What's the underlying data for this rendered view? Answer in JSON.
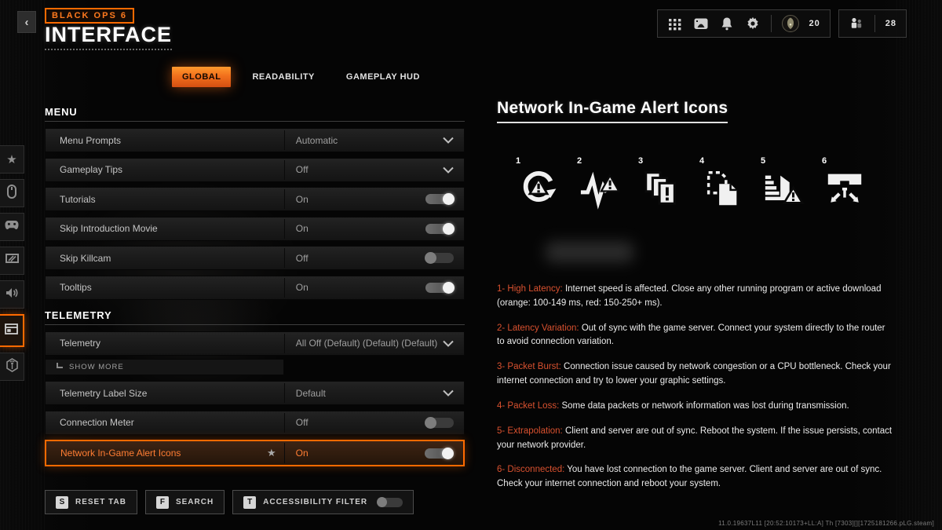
{
  "colors": {
    "accent": "#ff6a00",
    "alert_red": "#d9512f",
    "tab_active_bg": "#f2701c"
  },
  "header": {
    "back_icon": "‹",
    "game_badge": "BLACK OPS 6",
    "title": "INTERFACE"
  },
  "topbar": {
    "icons": [
      "grid-icon",
      "photo-icon",
      "bell-icon",
      "gear-icon"
    ],
    "currency_count": "20",
    "social_count": "28"
  },
  "tabs": [
    {
      "label": "GLOBAL",
      "active": true
    },
    {
      "label": "READABILITY",
      "active": false
    },
    {
      "label": "GAMEPLAY HUD",
      "active": false
    }
  ],
  "sidebar": {
    "items": [
      {
        "name": "favorites",
        "icon": "star-icon",
        "glyph": "★"
      },
      {
        "name": "mouse",
        "icon": "mouse-icon"
      },
      {
        "name": "controller",
        "icon": "gamepad-icon"
      },
      {
        "name": "display",
        "icon": "monitor-icon"
      },
      {
        "name": "audio",
        "icon": "speaker-icon"
      },
      {
        "name": "interface",
        "icon": "layout-icon",
        "active": true
      },
      {
        "name": "network",
        "icon": "antenna-icon"
      }
    ]
  },
  "settings": {
    "sections": [
      {
        "title": "MENU",
        "rows": [
          {
            "label": "Menu Prompts",
            "value": "Automatic",
            "control": "dropdown"
          },
          {
            "label": "Gameplay Tips",
            "value": "Off",
            "control": "dropdown"
          },
          {
            "label": "Tutorials",
            "value": "On",
            "control": "toggle",
            "state": "on"
          },
          {
            "label": "Skip Introduction Movie",
            "value": "On",
            "control": "toggle",
            "state": "on"
          },
          {
            "label": "Skip Killcam",
            "value": "Off",
            "control": "toggle",
            "state": "off"
          },
          {
            "label": "Tooltips",
            "value": "On",
            "control": "toggle",
            "state": "on"
          }
        ]
      },
      {
        "title": "TELEMETRY",
        "rows": [
          {
            "label": "Telemetry",
            "value": "All Off (Default) (Default) (Default)",
            "control": "dropdown",
            "subrow": "SHOW MORE"
          },
          {
            "label": "Telemetry Label Size",
            "value": "Default",
            "control": "dropdown"
          },
          {
            "label": "Connection Meter",
            "value": "Off",
            "control": "toggle",
            "state": "off"
          },
          {
            "label": "Network In-Game Alert Icons",
            "value": "On",
            "control": "toggle",
            "state": "on",
            "active": true,
            "starred": true,
            "star_glyph": "★"
          }
        ]
      }
    ]
  },
  "footer": {
    "buttons": [
      {
        "key": "S",
        "label": "RESET TAB"
      },
      {
        "key": "F",
        "label": "SEARCH"
      },
      {
        "key": "T",
        "label": "ACCESSIBILITY FILTER",
        "toggle": "off"
      }
    ],
    "version": "11.0.19637L11 [20:52:10173+LL:A] Th [7303][][1725181266.pLG.steam]"
  },
  "detail": {
    "title": "Network In-Game Alert Icons",
    "icons": [
      {
        "num": "1",
        "name": "high-latency-icon"
      },
      {
        "num": "2",
        "name": "latency-variation-icon"
      },
      {
        "num": "3",
        "name": "packet-burst-icon"
      },
      {
        "num": "4",
        "name": "packet-loss-icon"
      },
      {
        "num": "5",
        "name": "extrapolation-icon"
      },
      {
        "num": "6",
        "name": "disconnected-icon"
      }
    ],
    "descriptions": [
      {
        "lead": "1- High Latency:",
        "text": " Internet speed is affected. Close any other running program or active download (orange: 100-149 ms, red: 150-250+ ms)."
      },
      {
        "lead": "2- Latency Variation:",
        "text": " Out of sync with the game server. Connect your system directly to the router to avoid connection variation."
      },
      {
        "lead": "3- Packet Burst:",
        "text": " Connection issue caused by network congestion or a CPU bottleneck. Check your internet connection and try to lower your graphic settings."
      },
      {
        "lead": "4- Packet Loss:",
        "text": " Some data packets or network information was lost during transmission."
      },
      {
        "lead": "5- Extrapolation:",
        "text": " Client and server are out of sync. Reboot the system. If the issue persists, contact your network provider."
      },
      {
        "lead": "6- Disconnected:",
        "text": " You have lost connection to the game server. Client and server are out of sync. Check your internet connection and reboot your system."
      }
    ]
  }
}
